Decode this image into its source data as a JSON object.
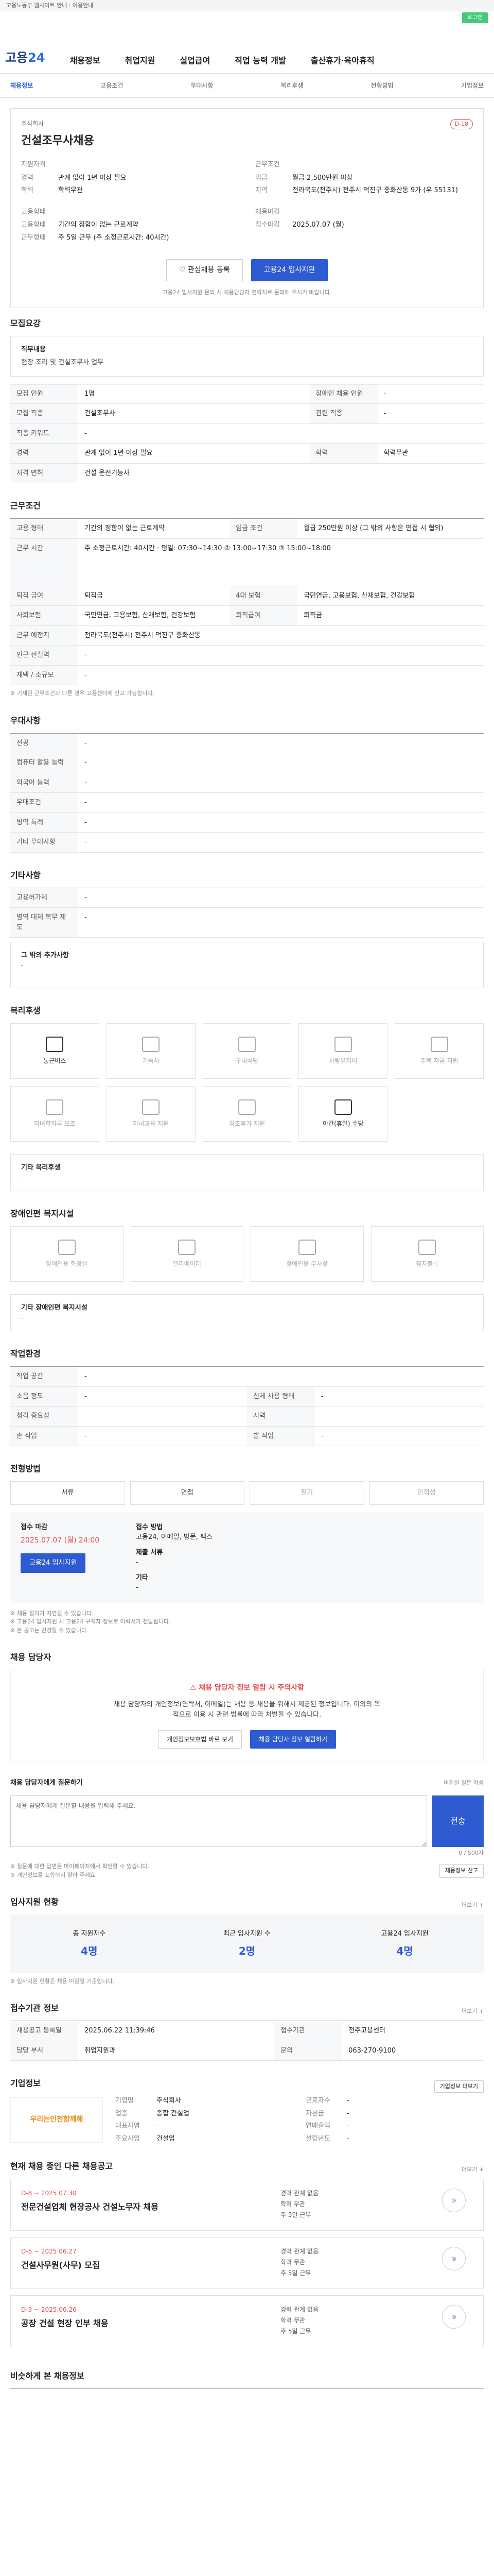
{
  "topbar": {
    "text": "고용노동부 웹사이트 안내 · 이용안내"
  },
  "brandbar": {
    "btn": "로그인"
  },
  "header": {
    "logo_prefix": "고용",
    "logo_suffix": "24",
    "menu": [
      "채용정보",
      "취업지원",
      "실업급여",
      "직업 능력 개발",
      "출산휴가·육아휴직"
    ]
  },
  "subnav": [
    "채용정보",
    "고용조건",
    "우대사항",
    "복리후생",
    "전형방법",
    "기업정보"
  ],
  "summary": {
    "company": "주식회사",
    "badge": "D-18",
    "title": "건설조무사채용",
    "left_title": "지원자격",
    "left_rows": [
      [
        "경력",
        "관계 없이 1년 이상 필요"
      ],
      [
        "학력",
        "학력무관"
      ]
    ],
    "left_title2": "고용형태",
    "left_rows2": [
      [
        "고용형태",
        "기간의 정함이 없는 근로계약"
      ],
      [
        "근무형태",
        "주 5일 근무 (주 소정근로시간: 40시간)"
      ]
    ],
    "right_title": "근무조건",
    "right_rows": [
      [
        "임금",
        "월급 2,500만원 이상"
      ],
      [
        "지역",
        "전라북도(전주시) 전주시 덕진구 중화산동 9가 (우 55131)"
      ]
    ],
    "right_title2": "채용마감",
    "right_rows2": [
      [
        "접수마감",
        "2025.07.07 (월)"
      ]
    ],
    "btn_save": "관심채용 등록",
    "btn_apply": "고용24 입사지원",
    "note": "고용24 입사지원 문의 시 채용담당자 연락처로 문의해 주시기 바랍니다."
  },
  "jobdesc": {
    "heading": "모집요강",
    "box_title": "직무내용",
    "box_text": "현장 조리 및 건설조무사 업무",
    "rows": [
      [
        "모집 인원",
        "1명",
        "장애인 채용 인원",
        "-"
      ],
      [
        "모집 직종",
        "건설조무사",
        "관련 직종",
        "-"
      ],
      [
        "직종 키워드",
        "-",
        "",
        ""
      ],
      [
        "경력",
        "관계 없이 1년 이상 필요",
        "학력",
        "학력무관"
      ],
      [
        "자격 면허",
        "건설 운전기능사",
        "",
        ""
      ]
    ]
  },
  "conditions": {
    "heading": "근무조건",
    "rows": [
      [
        "고용 형태",
        "기간의 정함이 없는 근로계약",
        "임금 조건",
        "월급 250만원 이상 (그 밖의 사항은 면접 시 협의)"
      ],
      [
        "근무 시간",
        "주 소정근로시간: 40시간 · 평일: 07:30~14:30 ② 13:00~17:30 ③ 15:00~18:00",
        "",
        ""
      ],
      [
        "퇴직 급여",
        "퇴직금",
        "4대 보험",
        "국민연금, 고용보험, 산재보험, 건강보험"
      ],
      [
        "사회보험",
        "국민연금, 고용보험, 산재보험, 건강보험",
        "퇴직급여",
        "퇴직금"
      ],
      [
        "근무 예정지",
        "전라북도(전주시) 전주시 덕진구 중화산동",
        "",
        ""
      ],
      [
        "인근 전철역",
        "-",
        "",
        ""
      ],
      [
        "재택 / 소규모",
        "-",
        "",
        ""
      ]
    ],
    "note": "※ 기재된 근무조건과 다른 경우 고용센터에 신고 가능합니다."
  },
  "pref": {
    "heading": "우대사항",
    "rows": [
      [
        "전공",
        "-"
      ],
      [
        "컴퓨터 활용 능력",
        "-"
      ],
      [
        "외국어 능력",
        "-"
      ],
      [
        "우대조건",
        "-"
      ],
      [
        "병역 특례",
        "-"
      ],
      [
        "기타 우대사항",
        "-"
      ]
    ]
  },
  "other": {
    "heading": "기타사항",
    "rows": [
      [
        "고용허가제",
        "-"
      ],
      [
        "병역 대체 복무 제도",
        "-"
      ]
    ],
    "box_title": "그 밖의 추가사항",
    "box_text": "-"
  },
  "welfare": {
    "heading": "복리후생",
    "items": [
      [
        "통근버스",
        true
      ],
      [
        "기숙사",
        false
      ],
      [
        "구내식당",
        false
      ],
      [
        "차량유지비",
        false
      ],
      [
        "주택 자금 지원",
        false
      ],
      [
        "자녀학자금 보조",
        false
      ],
      [
        "자녀교육 지원",
        false
      ],
      [
        "경조휴가 지원",
        false
      ],
      [
        "야간(휴일) 수당",
        true
      ]
    ],
    "box_title": "기타 복리후생",
    "box_text": "-"
  },
  "facility": {
    "heading": "장애인편 복지시설",
    "items": [
      "장애인용 화장실",
      "엘리베이터",
      "장애인용 주차장",
      "점자블록"
    ],
    "box_title": "기타 장애인편 복지시설",
    "box_text": "-"
  },
  "workenv": {
    "heading": "작업환경",
    "rows": [
      [
        "작업 공간",
        "-",
        "",
        ""
      ],
      [
        "소음 정도",
        "-",
        "신체 사용 형태",
        "-"
      ],
      [
        "청각 중요성",
        "-",
        "시력",
        "-"
      ],
      [
        "손 작업",
        "-",
        "발 작업",
        "-"
      ]
    ]
  },
  "selection": {
    "heading": "전형방법",
    "tabs": [
      "서류",
      "면접",
      "필기",
      "인적성"
    ],
    "left": [
      [
        "접수 마감",
        "2025.07.07 (월) 24:00"
      ]
    ],
    "right": [
      [
        "접수 방법",
        "고용24, 이메일, 방문, 팩스"
      ],
      [
        "제출 서류",
        "-"
      ],
      [
        "기타",
        "-"
      ]
    ],
    "btn": "고용24 입사지원",
    "notes": [
      "※ 채용 절차가 지연될 수 있습니다.",
      "※ 고용24 입사지원 시 고용24 구직자 정보로 이력서가 전달됩니다.",
      "※ 본 공고는 변경될 수 있습니다."
    ]
  },
  "contact": {
    "heading": "채용 담당자",
    "title": "채용 담당자 정보 열람 시 주의사항",
    "text": "채용 담당자의 개인정보(연락처, 이메일)는 채용 등 채용을 위해서 제공된 정보입니다. 이외의 목적으로 이용 시 관련 법률에 따라 처벌될 수 있습니다.",
    "btn1": "개인정보보호법 바로 보기",
    "btn2": "채용 담당자 정보 열람하기"
  },
  "qa": {
    "heading": "채용 담당자에게 질문하기",
    "hint": "비회원 질문 작성",
    "placeholder": "채용 담당자에게 질문할 내용을 입력해 주세요.",
    "count": "0 / 500자",
    "send": "전송",
    "notes": [
      "※ 질문에 대한 답변은 마이페이지에서 확인할 수 있습니다.",
      "※ 개인정보를 포함하지 말아 주세요."
    ],
    "btn": "채용정보 신고"
  },
  "status": {
    "heading": "입사지원 현황",
    "more": "더보기 +",
    "items": [
      [
        "총 지원자수",
        "4명"
      ],
      [
        "최근 입사지원 수",
        "2명"
      ],
      [
        "고용24 입사지원",
        "4명"
      ]
    ],
    "note": "※ 입사지원 현황은 채용 마감일 기준입니다."
  },
  "agency": {
    "heading": "접수기관 정보",
    "more": "더보기 +",
    "rows": [
      [
        "채용공고 등록일",
        "2025.06.22 11:39:46",
        "접수기관",
        "전주고용센터"
      ],
      [
        "담당 부서",
        "취업지원과",
        "문의",
        "063-270-9100"
      ]
    ]
  },
  "company": {
    "heading": "기업정보",
    "logo": "우리는인천함께해",
    "rows1": [
      [
        "기업명",
        "주식회사"
      ],
      [
        "업종",
        "종합 건설업"
      ],
      [
        "대표자명",
        "-"
      ],
      [
        "주요사업",
        "건설업"
      ]
    ],
    "rows2": [
      [
        "근로자수",
        "-"
      ],
      [
        "자본금",
        "-"
      ],
      [
        "연매출액",
        "-"
      ],
      [
        "설립년도",
        "-"
      ]
    ],
    "btn": "기업정보 더보기"
  },
  "related": {
    "heading": "현재 채용 중인 다른 채용공고",
    "more": "더보기 +",
    "jobs": [
      {
        "d": "D-8 ~ 2025.07.30",
        "t": "전문건설업체 현장공사 건설노무자 채용",
        "meta": [
          "경력 관계 없음",
          "학력 무관",
          "주 5일 근무"
        ]
      },
      {
        "d": "D-5 ~ 2025.06.27",
        "t": "건설사무원(사무) 모집",
        "meta": [
          "경력 관계 없음",
          "학력 무관",
          "주 5일 근무"
        ]
      },
      {
        "d": "D-3 ~ 2025.06.26",
        "t": "공장 건설 현장 인부 채용",
        "meta": [
          "경력 관계 없음",
          "학력 무관",
          "주 5일 근무"
        ]
      }
    ]
  },
  "recent": {
    "heading": "비슷하게 본 채용정보"
  }
}
